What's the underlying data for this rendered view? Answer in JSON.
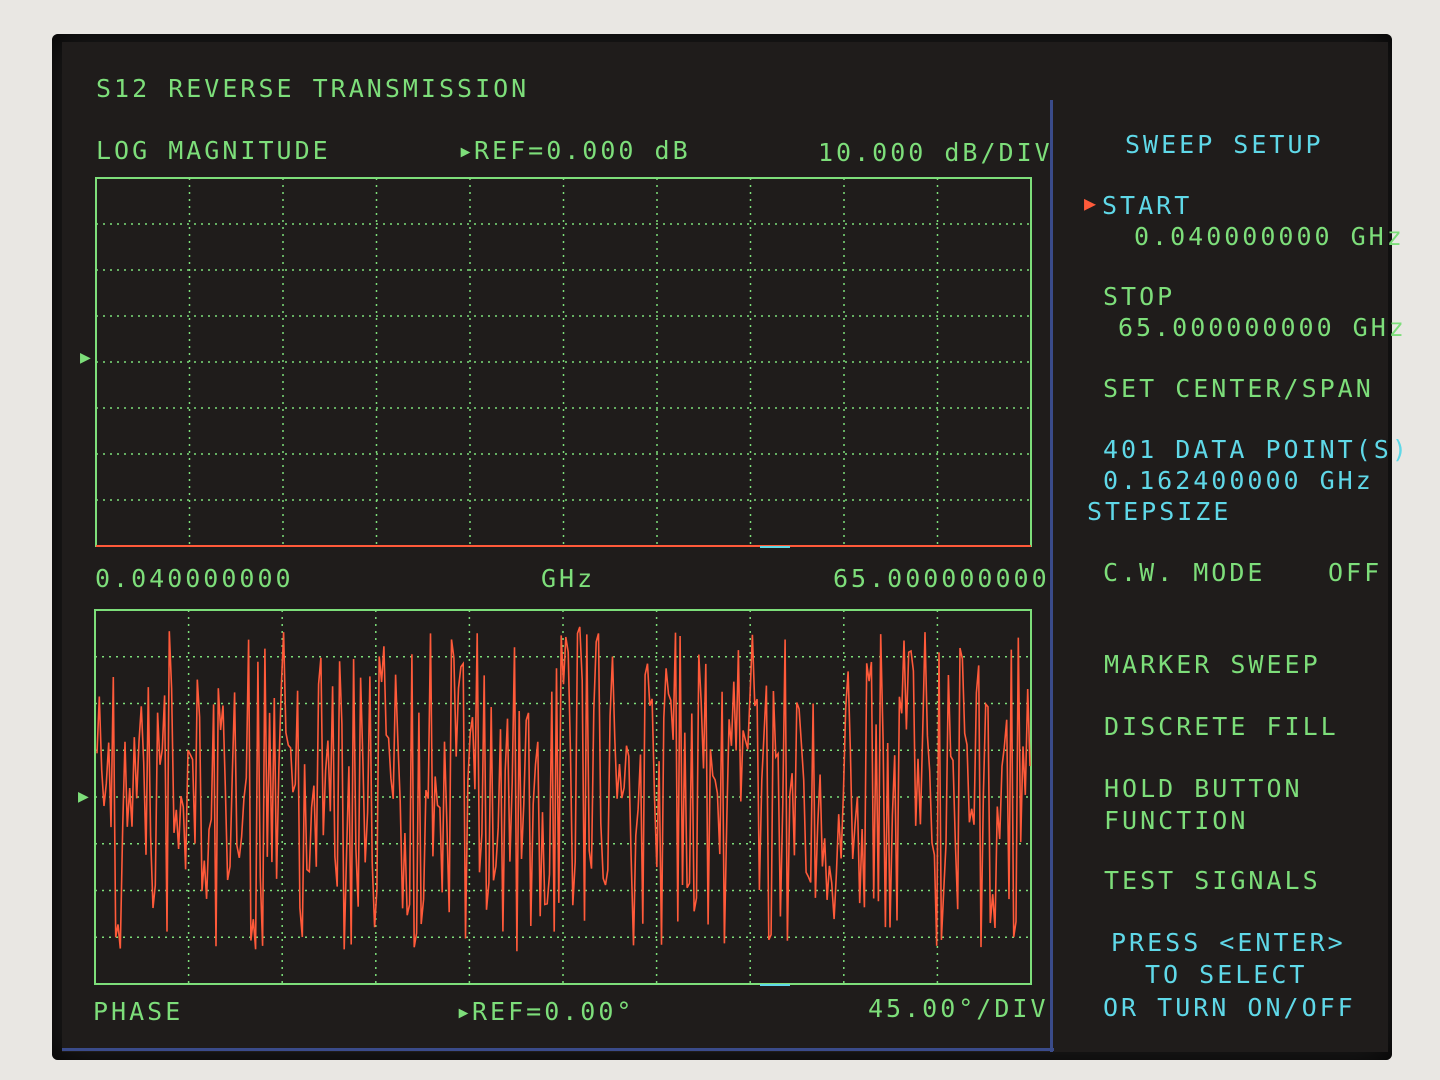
{
  "header": {
    "title": "S12 REVERSE TRANSMISSION"
  },
  "top_trace": {
    "format": "LOG MAGNITUDE",
    "ref_label": "REF=0.000 dB",
    "scale": "10.000 dB/DIV",
    "start": "0.040000000",
    "unit": "GHz",
    "stop": "65.000000000"
  },
  "bottom_trace": {
    "format": "PHASE",
    "ref_label": "REF=0.00°",
    "scale": "45.00°/DIV"
  },
  "menu": {
    "title": "SWEEP SETUP",
    "start_label": "START",
    "start_value": "0.040000000 GHz",
    "stop_label": "STOP",
    "stop_value": "65.000000000 GHz",
    "set_center_span": "SET CENTER/SPAN",
    "data_points": "401 DATA POINT(S)",
    "step_value": "0.162400000 GHz",
    "stepsize_label": "STEPSIZE",
    "cw_mode_label": "C.W. MODE",
    "cw_mode_value": "OFF",
    "marker_sweep": "MARKER SWEEP",
    "discrete_fill": "DISCRETE FILL",
    "hold_button_1": "HOLD BUTTON",
    "hold_button_2": "FUNCTION",
    "test_signals": "TEST SIGNALS",
    "press_enter_1": "PRESS <ENTER>",
    "press_enter_2": "TO SELECT",
    "press_enter_3": "OR TURN ON/OFF"
  },
  "colors": {
    "grid": "#7dde7a",
    "trace": "#ff5a3a",
    "menu_text": "#5fd8e8",
    "background": "#1f1c1b"
  }
}
